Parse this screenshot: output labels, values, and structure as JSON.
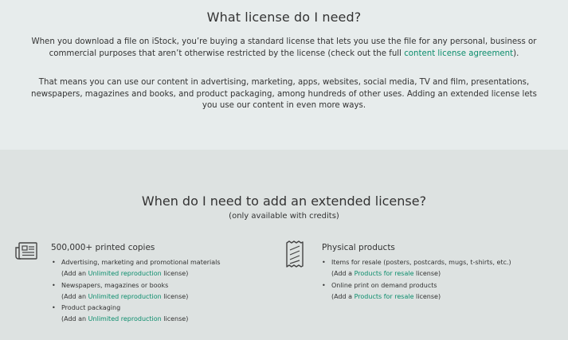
{
  "top": {
    "title": "What license do I need?",
    "para1_text": "When you download a file on iStock, you’re buying a standard license that lets you use the file for any personal, business or commercial purposes that aren’t otherwise restricted by the license (check out the full ",
    "para1_link": "content license agreement",
    "para1_end": ").",
    "para2": "That means you can use our content in advertising, marketing, apps, websites, social media, TV and film, presentations, newspapers, magazines and books, and product packaging, among hundreds of other uses. Adding an extended license lets you use our content in even more ways."
  },
  "extended": {
    "title": "When do I need to add an extended license?",
    "subtitle": "(only available with credits)",
    "columns": [
      {
        "icon": "newspaper-icon",
        "heading": "500,000+ printed copies",
        "items": [
          {
            "text": "Advertising, marketing and promotional materials",
            "note_pre": "(Add an ",
            "note_link": "Unlimited reproduction",
            "note_post": " license)"
          },
          {
            "text": "Newspapers, magazines or books",
            "note_pre": "(Add an ",
            "note_link": "Unlimited reproduction",
            "note_post": " license)"
          },
          {
            "text": "Product packaging",
            "note_pre": "(Add an ",
            "note_link": "Unlimited reproduction",
            "note_post": " license)"
          }
        ]
      },
      {
        "icon": "receipt-icon",
        "heading": "Physical products",
        "items": [
          {
            "text": "Items for resale (posters, postcards, mugs, t-shirts, etc.)",
            "note_pre": "(Add a ",
            "note_link": "Products for resale",
            "note_post": " license)"
          },
          {
            "text": "Online print on demand products",
            "note_pre": "(Add a ",
            "note_link": "Products for resale",
            "note_post": " license)"
          }
        ]
      }
    ]
  },
  "colors": {
    "link": "#0b8d6c",
    "text": "#333333",
    "top_bg": "#e7ecec",
    "bottom_bg": "#dde2e1"
  }
}
